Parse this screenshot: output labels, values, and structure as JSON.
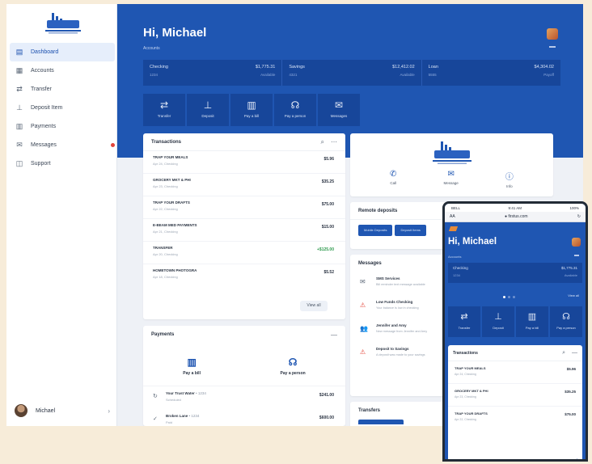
{
  "sidebar": {
    "items": [
      {
        "label": "Dashboard",
        "icon": "dashboard-icon",
        "glyph": "▤",
        "active": true
      },
      {
        "label": "Accounts",
        "icon": "accounts-icon",
        "glyph": "▦"
      },
      {
        "label": "Transfer",
        "icon": "transfer-icon",
        "glyph": "⇄"
      },
      {
        "label": "Deposit Item",
        "icon": "deposit-icon",
        "glyph": "⊥"
      },
      {
        "label": "Payments",
        "icon": "payments-icon",
        "glyph": "▥"
      },
      {
        "label": "Messages",
        "icon": "messages-icon",
        "glyph": "✉",
        "badge": true
      },
      {
        "label": "Support",
        "icon": "support-icon",
        "glyph": "◫"
      }
    ],
    "user": "Michael"
  },
  "hero": {
    "title": "Hi, Michael",
    "subtitle": "Accounts",
    "accounts": [
      {
        "name": "Checking",
        "sub": "1234",
        "balance": "$1,775.31",
        "balance_sub": "Available"
      },
      {
        "name": "Savings",
        "sub": "4321",
        "balance": "$12,412.02",
        "balance_sub": "Available"
      },
      {
        "name": "Loan",
        "sub": "5555",
        "balance": "$4,304.02",
        "balance_sub": "Payoff"
      }
    ],
    "quick_actions": [
      {
        "label": "Transfer",
        "glyph": "⇄"
      },
      {
        "label": "Deposit",
        "glyph": "⊥"
      },
      {
        "label": "Pay a bill",
        "glyph": "▥"
      },
      {
        "label": "Pay a person",
        "glyph": "☊"
      },
      {
        "label": "Messages",
        "glyph": "✉"
      }
    ]
  },
  "transactions": {
    "title": "Transactions",
    "items": [
      {
        "name": "TRAP YOUR MEALS",
        "sub": "Apr 24, Checking",
        "amount": "$5.96"
      },
      {
        "name": "GROCERY MKT & PHI",
        "sub": "Apr 23, Checking",
        "amount": "$35.25"
      },
      {
        "name": "TRAP YOUR DRAFTS",
        "sub": "Apr 22, Checking",
        "amount": "$75.00"
      },
      {
        "name": "E-BEAM MED PAYMENTS",
        "sub": "Apr 21, Checking",
        "amount": "$15.00"
      },
      {
        "name": "TRANSFER",
        "sub": "Apr 20, Checking",
        "amount": "+$125.00",
        "positive": true
      },
      {
        "name": "HOMETOWN PHOTOGRA",
        "sub": "Apr 18, Checking",
        "amount": "$5.52"
      }
    ],
    "view_all": "View all"
  },
  "payments": {
    "title": "Payments",
    "actions": [
      {
        "label": "Pay a bill",
        "glyph": "▥"
      },
      {
        "label": "Pay a person",
        "glyph": "☊"
      }
    ],
    "items": [
      {
        "name": "Your Trust Water",
        "tag": "• 1234",
        "sub": "Scheduled",
        "amount": "$241.00",
        "glyph": "↻"
      },
      {
        "name": "Broken Lane",
        "tag": "• 1234",
        "sub": "Paid",
        "amount": "$600.00",
        "glyph": "✓"
      }
    ]
  },
  "brand_card": {
    "actions": [
      {
        "label": "Call",
        "glyph": "✆"
      },
      {
        "label": "Message",
        "glyph": "✉"
      },
      {
        "label": "Info",
        "glyph": "ⓘ"
      }
    ]
  },
  "deposits": {
    "title": "Remote deposits",
    "buttons": [
      "Mobile Deposits",
      "Deposit Items"
    ]
  },
  "messages": {
    "title": "Messages",
    "items": [
      {
        "title": "SMS Services",
        "sub": "Bill reminder text message available",
        "glyph": "✉",
        "warn": false
      },
      {
        "title": "Low Funds Checking",
        "sub": "Your balance is low in checking",
        "glyph": "⚠",
        "warn": true
      },
      {
        "title": "Jennifer and Amy",
        "sub": "New message from Jennifer and Amy",
        "glyph": "👥",
        "warn": false
      },
      {
        "title": "Deposit to Savings",
        "sub": "A deposit was made to your savings",
        "glyph": "⚠",
        "warn": true
      }
    ]
  },
  "transfers": {
    "title": "Transfers"
  },
  "phone": {
    "status_left": "BELL",
    "status_time": "9:41 AM",
    "status_right": "100%",
    "url_left": "AA",
    "url": "● firstus.com",
    "url_right": "↻",
    "title": "Hi, Michael",
    "subtitle": "Accounts",
    "account": {
      "name": "Checking",
      "sub": "1234",
      "balance": "$1,775.31",
      "balance_sub": "Available"
    },
    "view_all": "View all",
    "quick_actions": [
      {
        "label": "Transfer",
        "glyph": "⇄"
      },
      {
        "label": "Deposit",
        "glyph": "⊥"
      },
      {
        "label": "Pay a bill",
        "glyph": "▥"
      },
      {
        "label": "Pay a person",
        "glyph": "☊"
      }
    ],
    "transactions_title": "Transactions",
    "transactions": [
      {
        "name": "TRAP YOUR MEALS",
        "sub": "Apr 24, Checking",
        "amount": "$5.96"
      },
      {
        "name": "GROCERY MKT & PHI",
        "sub": "Apr 23, Checking",
        "amount": "$35.25"
      },
      {
        "name": "TRAP YOUR DRAFTS",
        "sub": "Apr 22, Checking",
        "amount": "$75.00"
      }
    ]
  },
  "colors": {
    "brand_blue": "#1f56b2",
    "dark_blue": "#17469a",
    "background": "#f7ecd9",
    "positive": "#2e9a4e",
    "alert": "#e3453a"
  }
}
